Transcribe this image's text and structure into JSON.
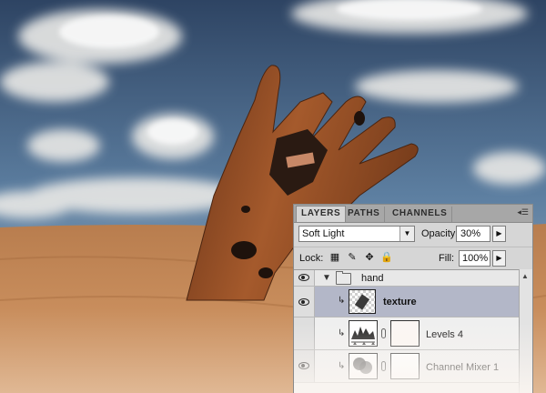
{
  "panel": {
    "tabs": [
      {
        "label": "LAYERS",
        "active": true
      },
      {
        "label": "PATHS",
        "active": false
      },
      {
        "label": "CHANNELS",
        "active": false
      }
    ],
    "menu_icon": "panel-menu-icon",
    "blend_mode": "Soft Light",
    "opacity_label": "Opacity:",
    "opacity_value": "30%",
    "lock_label": "Lock:",
    "fill_label": "Fill:",
    "fill_value": "100%",
    "layers": [
      {
        "name": "hand",
        "kind": "group",
        "visible": true,
        "expanded": true
      },
      {
        "name": "texture",
        "kind": "pixel",
        "visible": true,
        "selected": true,
        "clipped": true
      },
      {
        "name": "Levels 4",
        "kind": "adjustment",
        "visible": false,
        "clipped": true
      },
      {
        "name": "Channel Mixer 1",
        "kind": "adjustment",
        "visible": true,
        "clipped": true
      }
    ]
  },
  "colors": {
    "sky": "#4a6a8e",
    "sand": "#b5784a",
    "panel_bg": "#d6d6d6",
    "selected_row": "#b3b7c8"
  }
}
